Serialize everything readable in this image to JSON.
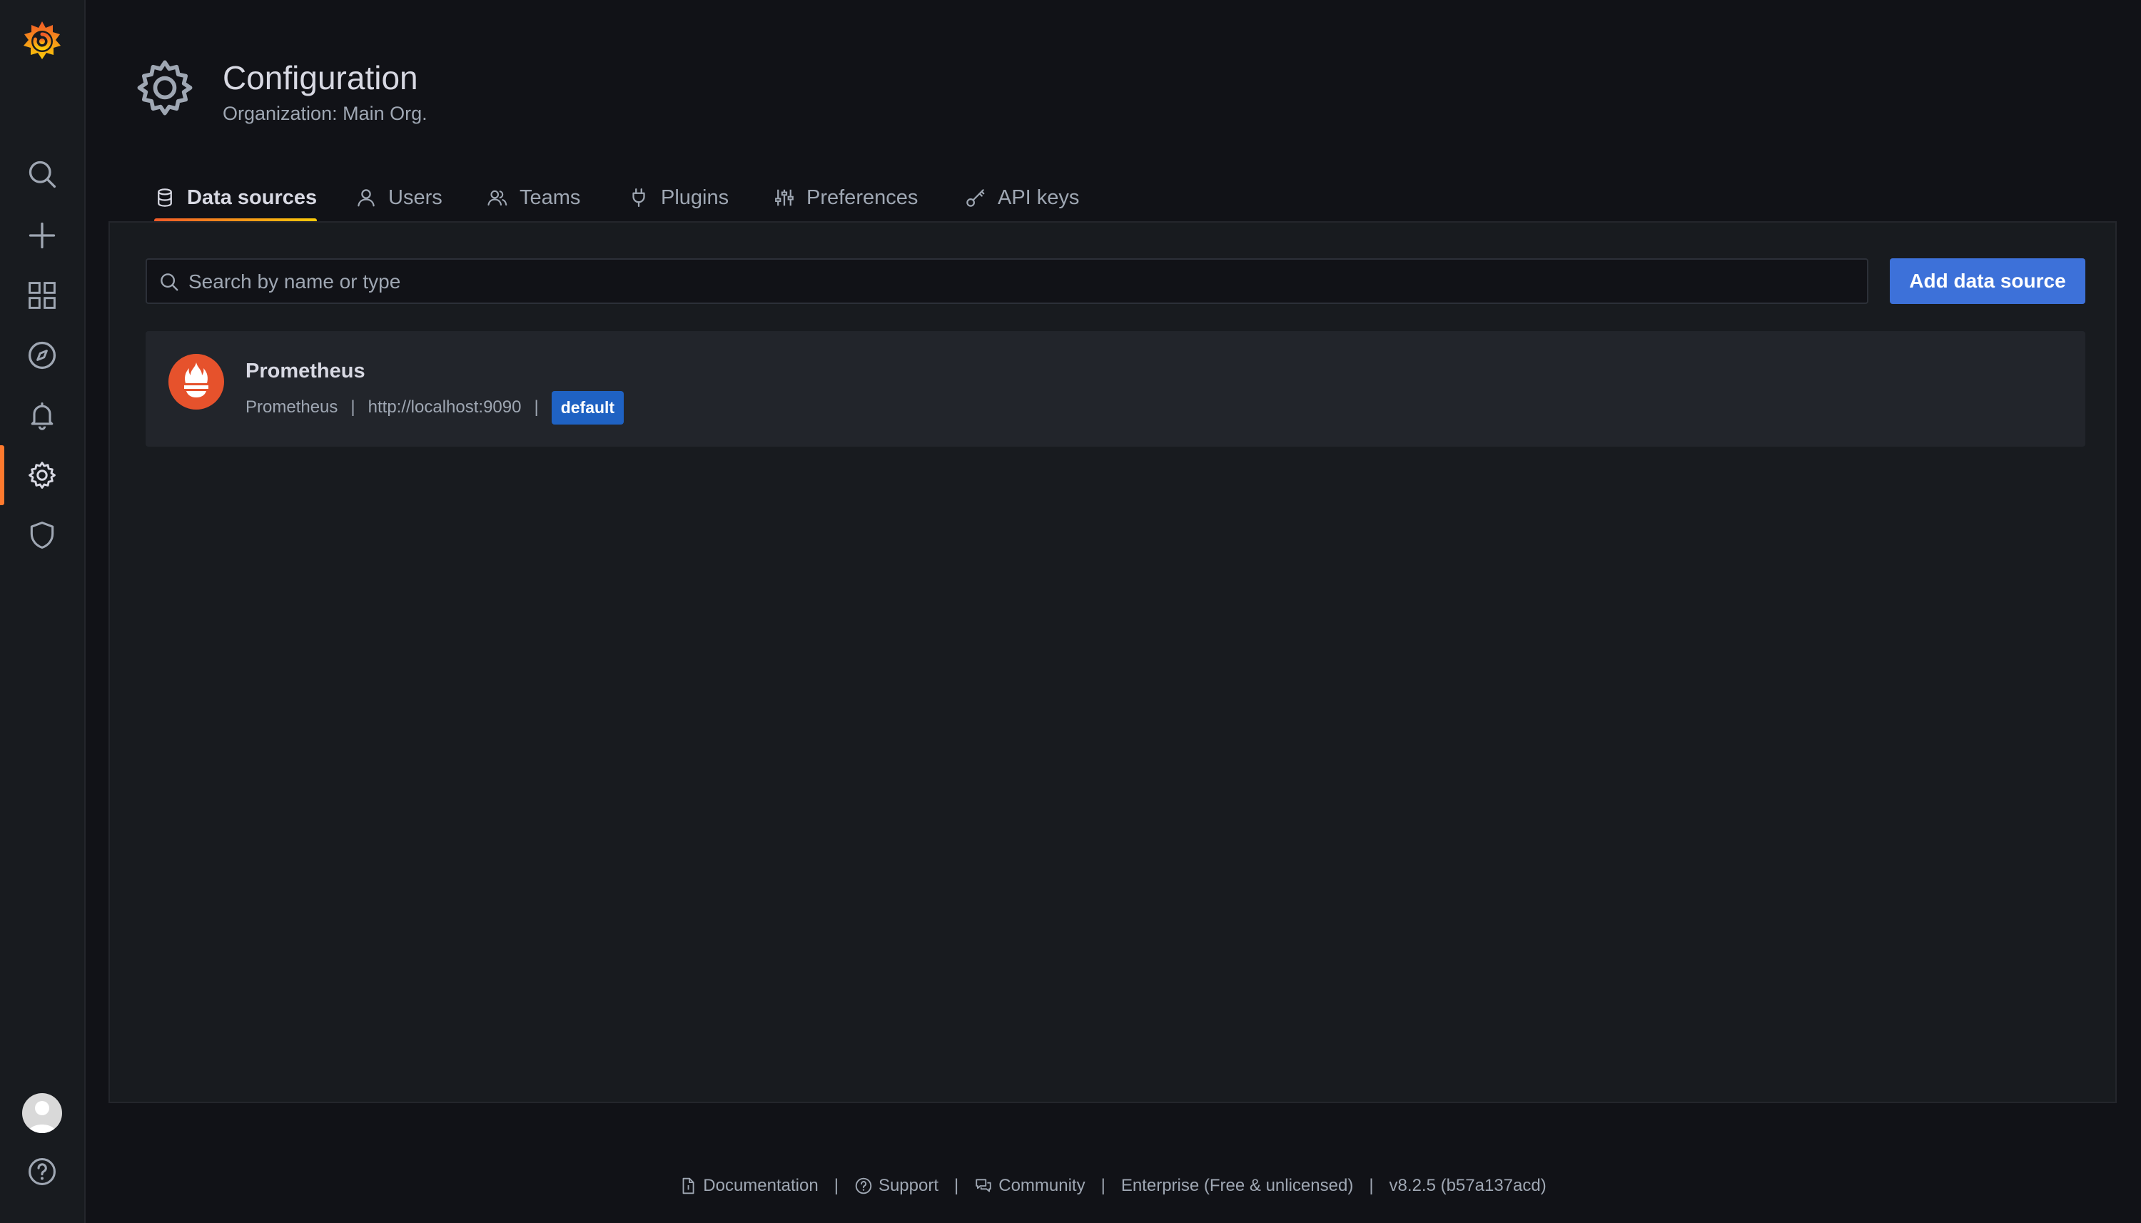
{
  "header": {
    "title": "Configuration",
    "subtitle": "Organization: Main Org.",
    "icon": "gear-icon"
  },
  "sidebar": {
    "items": [
      {
        "name": "search",
        "icon": "search-icon"
      },
      {
        "name": "create",
        "icon": "plus-icon"
      },
      {
        "name": "dashboards",
        "icon": "apps-icon"
      },
      {
        "name": "explore",
        "icon": "compass-icon"
      },
      {
        "name": "alerting",
        "icon": "bell-icon"
      },
      {
        "name": "configuration",
        "icon": "gear-icon",
        "active": true
      },
      {
        "name": "server-admin",
        "icon": "shield-icon"
      }
    ],
    "bottom": [
      {
        "name": "profile",
        "icon": "avatar"
      },
      {
        "name": "help",
        "icon": "question-circle-icon"
      }
    ]
  },
  "tabs": [
    {
      "label": "Data sources",
      "icon": "database-icon",
      "active": true
    },
    {
      "label": "Users",
      "icon": "user-icon"
    },
    {
      "label": "Teams",
      "icon": "users-icon"
    },
    {
      "label": "Plugins",
      "icon": "plug-icon"
    },
    {
      "label": "Preferences",
      "icon": "sliders-icon"
    },
    {
      "label": "API keys",
      "icon": "key-icon"
    }
  ],
  "search": {
    "placeholder": "Search by name or type",
    "value": ""
  },
  "add_button_label": "Add data source",
  "datasources": [
    {
      "name": "Prometheus",
      "type": "Prometheus",
      "url": "http://localhost:9090",
      "separator": "|",
      "badge": "default",
      "logo": "prometheus-logo"
    }
  ],
  "footer": {
    "documentation": "Documentation",
    "support": "Support",
    "community": "Community",
    "edition": "Enterprise (Free & unlicensed)",
    "version": "v8.2.5 (b57a137acd)",
    "separator": "|"
  },
  "colors": {
    "background": "#111217",
    "panel": "#181b1f",
    "accent": "#ff7a2e",
    "primary_button": "#3d71d9",
    "badge": "#1f62c3",
    "prometheus": "#e6522c"
  }
}
